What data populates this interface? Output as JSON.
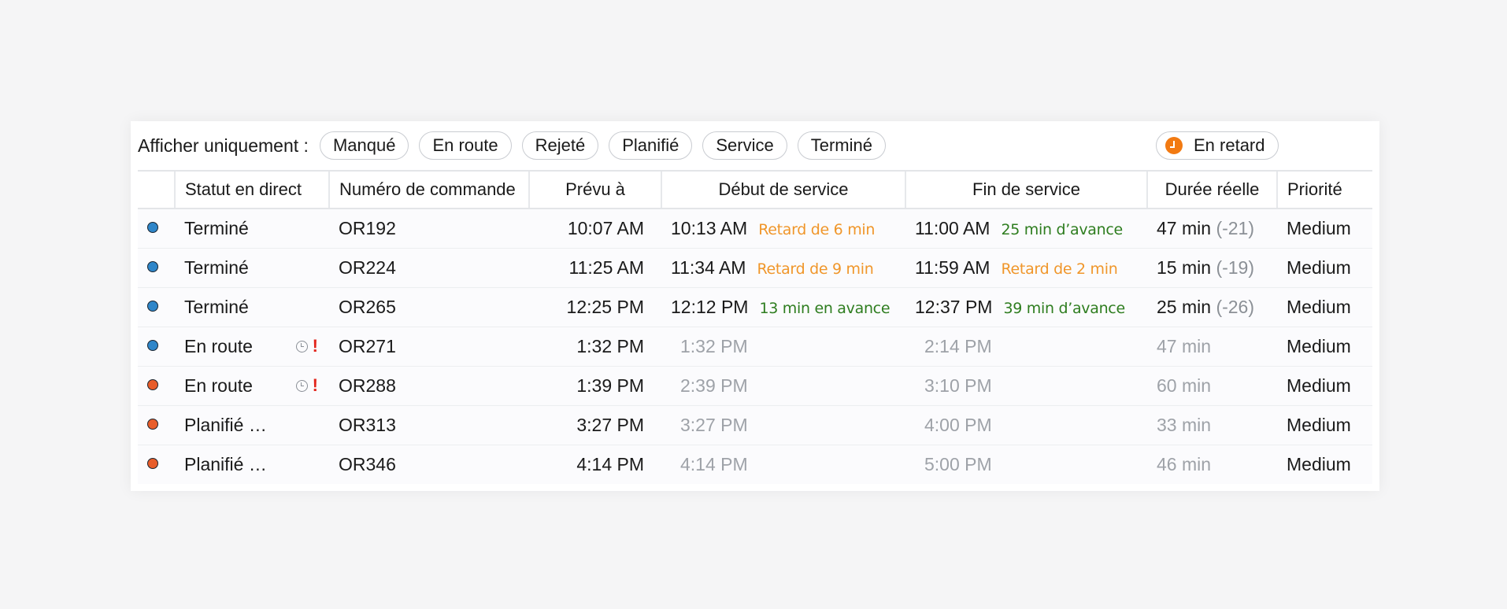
{
  "filter": {
    "label": "Afficher uniquement :",
    "chips": [
      "Manqué",
      "En route",
      "Rejeté",
      "Planifié",
      "Service",
      "Terminé"
    ],
    "late_chip": "En retard",
    "late_icon": "clock-icon"
  },
  "colors": {
    "dot_blue": "#2f86c9",
    "dot_orange": "#e85d2a",
    "late": "#f0962a",
    "early": "#2e7d1f",
    "alert": "#e2231a"
  },
  "columns": [
    "Statut en direct",
    "Numéro de commande",
    "Prévu à",
    "Début de service",
    "Fin de service",
    "Durée réelle",
    "Priorité"
  ],
  "rows": [
    {
      "dot": "blue",
      "status": "Terminé",
      "flags": false,
      "order": "OR192",
      "planned": "10:07 AM",
      "start": "10:13 AM",
      "start_note": "Retard de 6 min",
      "start_note_type": "late",
      "end": "11:00 AM",
      "end_note": "25 min d’avance",
      "end_note_type": "early",
      "duration": "47 min",
      "duration_diff": "(-21)",
      "priority": "Medium",
      "muted": false
    },
    {
      "dot": "blue",
      "status": "Terminé",
      "flags": false,
      "order": "OR224",
      "planned": "11:25 AM",
      "start": "11:34 AM",
      "start_note": "Retard de 9 min",
      "start_note_type": "late",
      "end": "11:59 AM",
      "end_note": "Retard de 2 min",
      "end_note_type": "late",
      "duration": "15 min",
      "duration_diff": "(-19)",
      "priority": "Medium",
      "muted": false
    },
    {
      "dot": "blue",
      "status": "Terminé",
      "flags": false,
      "order": "OR265",
      "planned": "12:25 PM",
      "start": "12:12 PM",
      "start_note": "13 min en avance",
      "start_note_type": "early",
      "end": "12:37 PM",
      "end_note": "39 min d’avance",
      "end_note_type": "early",
      "duration": "25 min",
      "duration_diff": "(-26)",
      "priority": "Medium",
      "muted": false
    },
    {
      "dot": "blue",
      "status": "En route",
      "flags": true,
      "order": "OR271",
      "planned": "1:32 PM",
      "start": "1:32 PM",
      "start_note": "",
      "start_note_type": "",
      "end": "2:14 PM",
      "end_note": "",
      "end_note_type": "",
      "duration": "47 min",
      "duration_diff": "",
      "priority": "Medium",
      "muted": true
    },
    {
      "dot": "orange",
      "status": "En route",
      "flags": true,
      "order": "OR288",
      "planned": "1:39 PM",
      "start": "2:39 PM",
      "start_note": "",
      "start_note_type": "",
      "end": "3:10 PM",
      "end_note": "",
      "end_note_type": "",
      "duration": "60 min",
      "duration_diff": "",
      "priority": "Medium",
      "muted": true
    },
    {
      "dot": "orange",
      "status": "Planifié …",
      "flags": false,
      "order": "OR313",
      "planned": "3:27 PM",
      "start": "3:27 PM",
      "start_note": "",
      "start_note_type": "",
      "end": "4:00 PM",
      "end_note": "",
      "end_note_type": "",
      "duration": "33 min",
      "duration_diff": "",
      "priority": "Medium",
      "muted": true
    },
    {
      "dot": "orange",
      "status": "Planifié …",
      "flags": false,
      "order": "OR346",
      "planned": "4:14 PM",
      "start": "4:14 PM",
      "start_note": "",
      "start_note_type": "",
      "end": "5:00 PM",
      "end_note": "",
      "end_note_type": "",
      "duration": "46 min",
      "duration_diff": "",
      "priority": "Medium",
      "muted": true
    }
  ]
}
